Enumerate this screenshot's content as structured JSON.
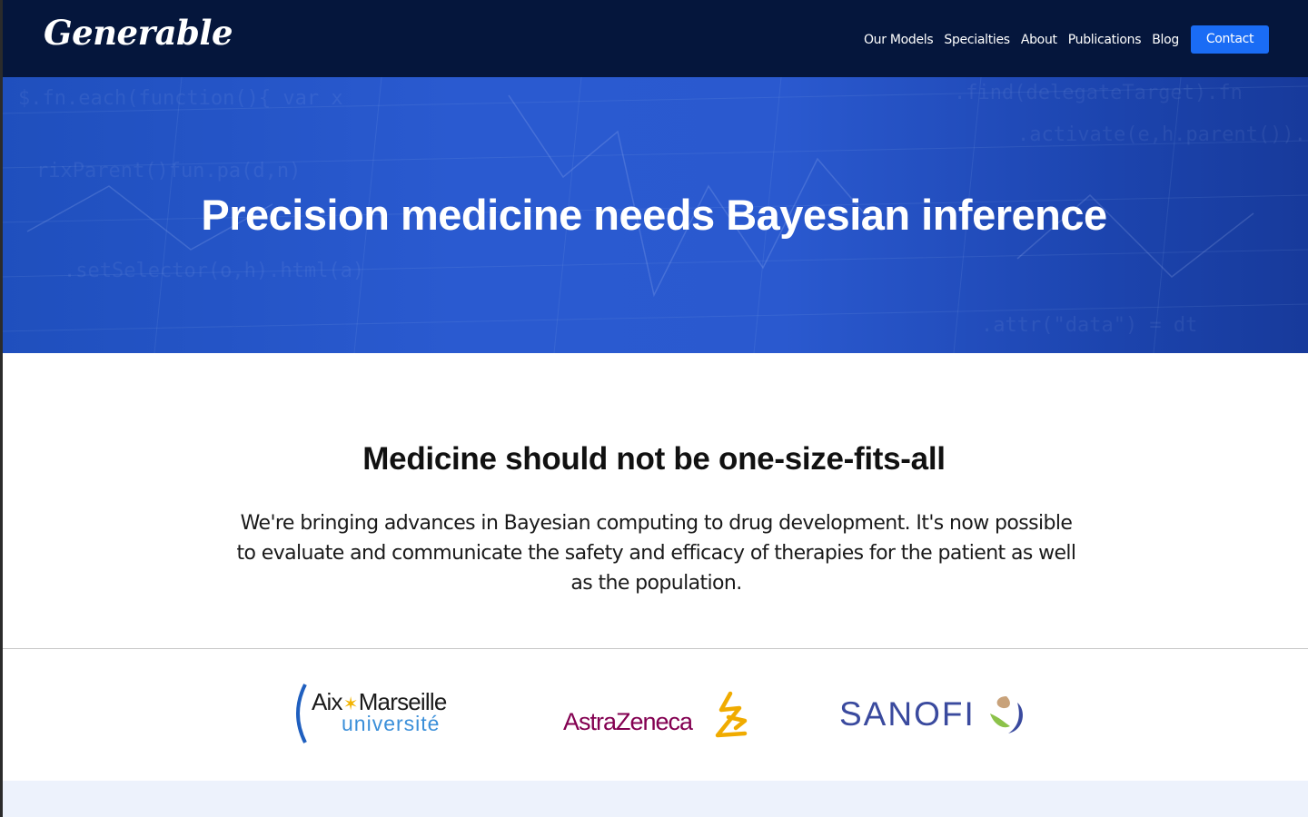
{
  "brand": {
    "logo_text": "Generable"
  },
  "nav": {
    "links": [
      "Our Models",
      "Specialties",
      "About",
      "Publications",
      "Blog"
    ],
    "contact_label": "Contact"
  },
  "hero": {
    "title": "Precision medicine needs Bayesian inference"
  },
  "intro": {
    "heading": "Medicine should not be one-size-fits-all",
    "body": "We're bringing advances in Bayesian computing to drug development. It's now possible to evaluate and communicate the safety and efficacy of therapies for the patient as well as the population."
  },
  "partners": {
    "amu": {
      "line1_a": "Aix",
      "line1_b": "Marseille",
      "line2": "université"
    },
    "astrazeneca": {
      "text": "AstraZeneca"
    },
    "sanofi": {
      "text": "SANOFI"
    }
  },
  "colors": {
    "navbar": "#05163c",
    "hero": "#2a59cf",
    "contact_button": "#1a6cf5",
    "astrazeneca": "#830051",
    "sanofi": "#3a4a9e",
    "amu_blue": "#3b8fd9",
    "bottom_band": "#edf2fc"
  }
}
